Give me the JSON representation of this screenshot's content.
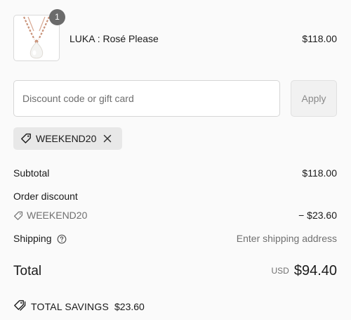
{
  "cart": {
    "item": {
      "name": "LUKA : Rosé Please",
      "price": "$118.00",
      "quantity": "1",
      "image": "necklace-product-image"
    }
  },
  "discount": {
    "placeholder": "Discount code or gift card",
    "value": "",
    "apply_label": "Apply",
    "applied_code": "WEEKEND20"
  },
  "summary": {
    "subtotal_label": "Subtotal",
    "subtotal_value": "$118.00",
    "order_discount_label": "Order discount",
    "order_discount_code": "WEEKEND20",
    "order_discount_value": "− $23.60",
    "shipping_label": "Shipping",
    "shipping_value": "Enter shipping address",
    "total_label": "Total",
    "total_currency": "USD",
    "total_value": "$94.40",
    "savings_label": "TOTAL SAVINGS",
    "savings_value": "$23.60"
  },
  "colors": {
    "background": "#fafafa",
    "chip_bg": "#e8e8e8",
    "badge_bg": "#6b6b6b",
    "muted_text": "#707070"
  }
}
